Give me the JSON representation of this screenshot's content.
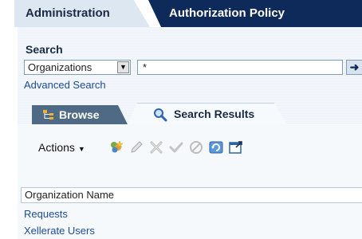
{
  "tabs": [
    {
      "label": "Administration"
    },
    {
      "label": "Authorization Policy"
    }
  ],
  "search": {
    "label": "Search",
    "type_selected": "Organizations",
    "query_value": "*",
    "advanced_link": "Advanced Search"
  },
  "subtabs": [
    {
      "label": "Browse",
      "icon": "org-tree-icon"
    },
    {
      "label": "Search Results",
      "icon": "magnifier-icon"
    }
  ],
  "toolbar": {
    "actions_label": "Actions",
    "icons": [
      "create-org-icon",
      "edit-icon",
      "delete-icon",
      "enable-icon",
      "disable-icon",
      "refresh-icon",
      "detach-icon"
    ]
  },
  "table": {
    "column_header": "Organization Name",
    "rows": [
      {
        "name": "Requests"
      },
      {
        "name": "Xellerate Users"
      }
    ]
  },
  "colors": {
    "dark_tab": "#0d2a5a",
    "light_tab": "#dde7f2",
    "link": "#1b4c9a",
    "browse_tab": "#4e6a85"
  }
}
